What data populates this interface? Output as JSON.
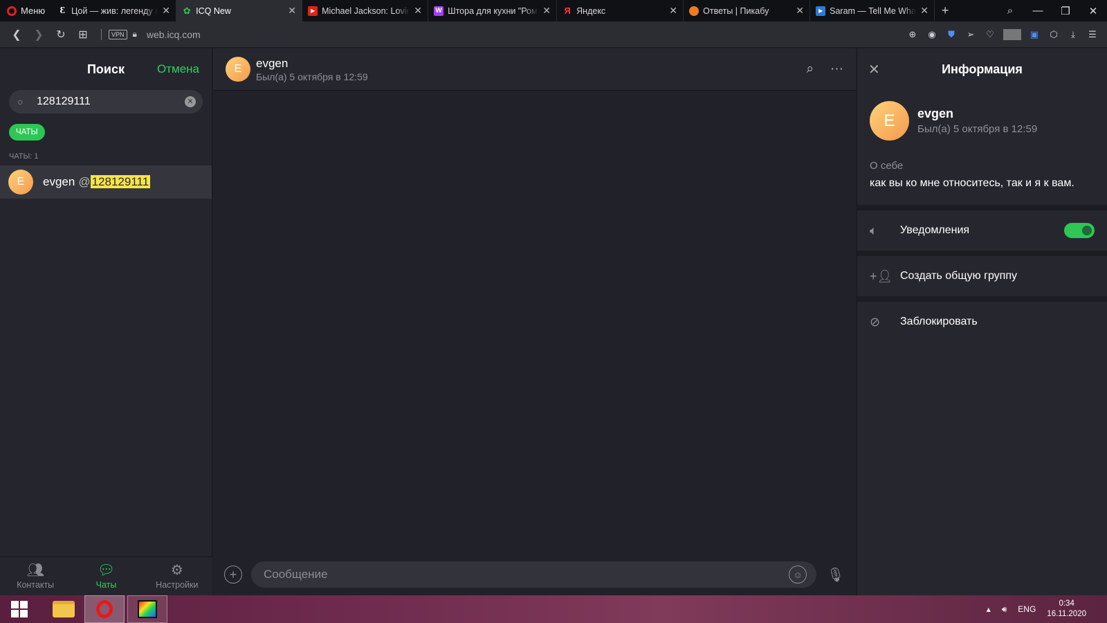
{
  "browser": {
    "menu_label": "Меню",
    "tabs": [
      {
        "title": "Цой — жив: легенду му",
        "favicon": "wiki-icon",
        "active": false
      },
      {
        "title": "ICQ New",
        "favicon": "icq-icon",
        "active": true
      },
      {
        "title": "Michael Jackson: Loving",
        "favicon": "youtube-icon",
        "active": false
      },
      {
        "title": "Штора для кухни \"Роме",
        "favicon": "wildberries-icon",
        "active": false
      },
      {
        "title": "Яндекс",
        "favicon": "yandex-icon",
        "active": false
      },
      {
        "title": "Ответы | Пикабу",
        "favicon": "pikabu-icon",
        "active": false
      },
      {
        "title": "Saram — Tell Me What H",
        "favicon": "video-icon",
        "active": false
      }
    ],
    "vpn_label": "VPN",
    "url_domain": "web.icq.com"
  },
  "left": {
    "title": "Поиск",
    "cancel": "Отмена",
    "search_value": "128129111",
    "chip": "ЧАТЫ",
    "section": "ЧАТЫ: 1",
    "result": {
      "initial": "E",
      "name": "evgen",
      "at": "@",
      "handle": "128129111"
    },
    "nav": [
      {
        "label": "Контакты",
        "icon": "contacts-icon"
      },
      {
        "label": "Чаты",
        "icon": "chats-icon"
      },
      {
        "label": "Настройки",
        "icon": "settings-icon"
      }
    ]
  },
  "chat": {
    "initial": "E",
    "name": "evgen",
    "status": "Был(а) 5 октября в 12:59",
    "composer_placeholder": "Сообщение"
  },
  "info": {
    "title": "Информация",
    "initial": "E",
    "name": "evgen",
    "status": "Был(а) 5 октября в 12:59",
    "about_label": "О себе",
    "about_text": "как вы ко мне относитесь, так и я к вам.",
    "notifications": "Уведомления",
    "notifications_on": true,
    "create_group": "Создать общую группу",
    "block": "Заблокировать"
  },
  "taskbar": {
    "lang": "ENG",
    "time": "0:34",
    "date": "16.11.2020"
  },
  "colors": {
    "accent_green": "#2fc655",
    "highlight_yellow": "#f7e44a",
    "panel_bg": "#25262d"
  }
}
